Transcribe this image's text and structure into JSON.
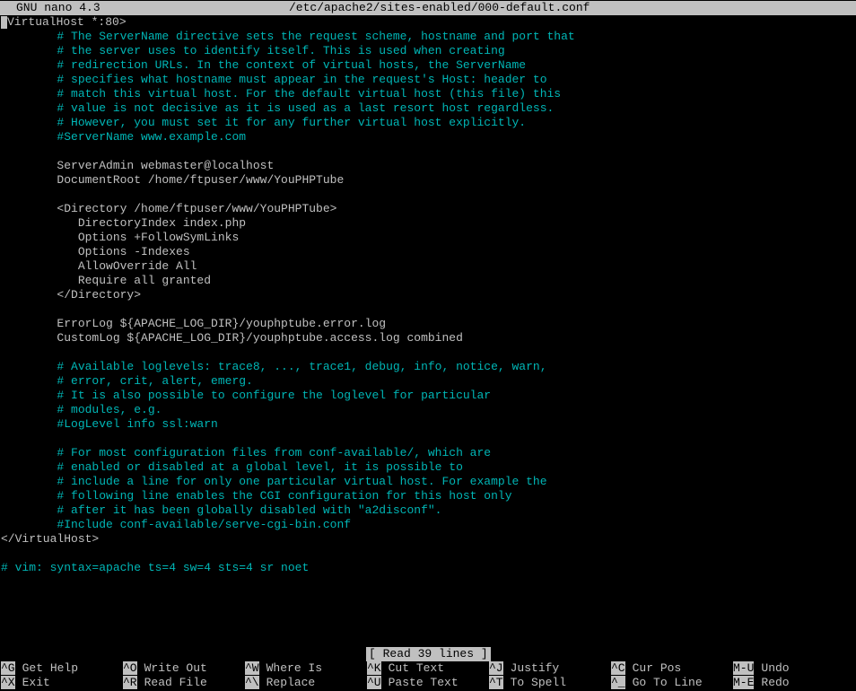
{
  "titlebar": {
    "app_name": "GNU nano 4.3",
    "file_path": "/etc/apache2/sites-enabled/000-default.conf"
  },
  "editor": {
    "first_line_rest": "VirtualHost *:80>",
    "lines": [
      {
        "text": "        # The ServerName directive sets the request scheme, hostname and port that",
        "type": "comment"
      },
      {
        "text": "        # the server uses to identify itself. This is used when creating",
        "type": "comment"
      },
      {
        "text": "        # redirection URLs. In the context of virtual hosts, the ServerName",
        "type": "comment"
      },
      {
        "text": "        # specifies what hostname must appear in the request's Host: header to",
        "type": "comment"
      },
      {
        "text": "        # match this virtual host. For the default virtual host (this file) this",
        "type": "comment"
      },
      {
        "text": "        # value is not decisive as it is used as a last resort host regardless.",
        "type": "comment"
      },
      {
        "text": "        # However, you must set it for any further virtual host explicitly.",
        "type": "comment"
      },
      {
        "text": "        #ServerName www.example.com",
        "type": "comment"
      },
      {
        "text": "",
        "type": "code"
      },
      {
        "text": "        ServerAdmin webmaster@localhost",
        "type": "code"
      },
      {
        "text": "        DocumentRoot /home/ftpuser/www/YouPHPTube",
        "type": "code"
      },
      {
        "text": "",
        "type": "code"
      },
      {
        "text": "        <Directory /home/ftpuser/www/YouPHPTube>",
        "type": "code"
      },
      {
        "text": "           DirectoryIndex index.php",
        "type": "code"
      },
      {
        "text": "           Options +FollowSymLinks",
        "type": "code"
      },
      {
        "text": "           Options -Indexes",
        "type": "code"
      },
      {
        "text": "           AllowOverride All",
        "type": "code"
      },
      {
        "text": "           Require all granted",
        "type": "code"
      },
      {
        "text": "        </Directory>",
        "type": "code"
      },
      {
        "text": "",
        "type": "code"
      },
      {
        "text": "        ErrorLog ${APACHE_LOG_DIR}/youphptube.error.log",
        "type": "code"
      },
      {
        "text": "        CustomLog ${APACHE_LOG_DIR}/youphptube.access.log combined",
        "type": "code"
      },
      {
        "text": "",
        "type": "code"
      },
      {
        "text": "        # Available loglevels: trace8, ..., trace1, debug, info, notice, warn,",
        "type": "comment"
      },
      {
        "text": "        # error, crit, alert, emerg.",
        "type": "comment"
      },
      {
        "text": "        # It is also possible to configure the loglevel for particular",
        "type": "comment"
      },
      {
        "text": "        # modules, e.g.",
        "type": "comment"
      },
      {
        "text": "        #LogLevel info ssl:warn",
        "type": "comment"
      },
      {
        "text": "",
        "type": "code"
      },
      {
        "text": "        # For most configuration files from conf-available/, which are",
        "type": "comment"
      },
      {
        "text": "        # enabled or disabled at a global level, it is possible to",
        "type": "comment"
      },
      {
        "text": "        # include a line for only one particular virtual host. For example the",
        "type": "comment"
      },
      {
        "text": "        # following line enables the CGI configuration for this host only",
        "type": "comment"
      },
      {
        "text": "        # after it has been globally disabled with \"a2disconf\".",
        "type": "comment"
      },
      {
        "text": "        #Include conf-available/serve-cgi-bin.conf",
        "type": "comment"
      },
      {
        "text": "</VirtualHost>",
        "type": "code"
      },
      {
        "text": "",
        "type": "code"
      },
      {
        "text": "# vim: syntax=apache ts=4 sw=4 sts=4 sr noet",
        "type": "comment"
      }
    ]
  },
  "status": {
    "message": "[ Read 39 lines ]"
  },
  "shortcuts": {
    "row1": [
      {
        "key": "^G",
        "label": "Get Help"
      },
      {
        "key": "^O",
        "label": "Write Out"
      },
      {
        "key": "^W",
        "label": "Where Is"
      },
      {
        "key": "^K",
        "label": "Cut Text"
      },
      {
        "key": "^J",
        "label": "Justify"
      },
      {
        "key": "^C",
        "label": "Cur Pos"
      },
      {
        "key": "M-U",
        "label": "Undo"
      }
    ],
    "row2": [
      {
        "key": "^X",
        "label": "Exit"
      },
      {
        "key": "^R",
        "label": "Read File"
      },
      {
        "key": "^\\",
        "label": "Replace"
      },
      {
        "key": "^U",
        "label": "Paste Text"
      },
      {
        "key": "^T",
        "label": "To Spell"
      },
      {
        "key": "^_",
        "label": "Go To Line"
      },
      {
        "key": "M-E",
        "label": "Redo"
      }
    ]
  },
  "colors": {
    "background": "#000000",
    "foreground": "#c0c0c0",
    "comment": "#00b6b6",
    "bar": "#c0c0c0"
  }
}
